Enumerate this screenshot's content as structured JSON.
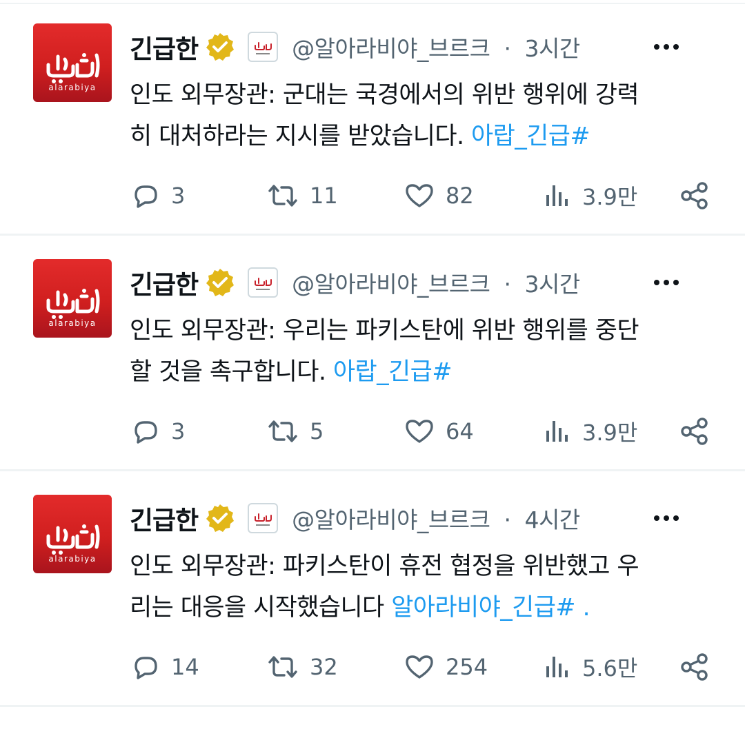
{
  "tweets": [
    {
      "display_name": "긴급한",
      "handle": "@알아라비야_브르크",
      "separator": "·",
      "time": "3시간",
      "text_lines": [
        "인도 외무장관: 군대는 국경에서의 위반 행위에 강력",
        "히 대처하라는 지시를 받았습니다. "
      ],
      "hashtag": "아랍_긴급#",
      "replies": "3",
      "retweets": "11",
      "likes": "82",
      "views": "3.9만"
    },
    {
      "display_name": "긴급한",
      "handle": "@알아라비야_브르크",
      "separator": "·",
      "time": "3시간",
      "text_lines": [
        "인도 외무장관: 우리는 파키스탄에 위반 행위를 중단",
        "할 것을 촉구합니다.   "
      ],
      "hashtag": "아랍_긴급#",
      "replies": "3",
      "retweets": "5",
      "likes": "64",
      "views": "3.9만"
    },
    {
      "display_name": "긴급한",
      "handle": "@알아라비야_브르크",
      "separator": "·",
      "time": "4시간",
      "text_lines": [
        "인도 외무장관: 파키스탄이 휴전 협정을 위반했고 우",
        "리는 대응을 시작했습니다   "
      ],
      "hashtag": "알아라비야_긴급# .",
      "replies": "14",
      "retweets": "32",
      "likes": "254",
      "views": "5.6만"
    }
  ],
  "brand": {
    "avatar_logo_text": "العربية",
    "avatar_subtext": "alarabiya"
  },
  "colors": {
    "hashtag": "#1d9bf0",
    "secondary_text": "#536471",
    "verified_gold": "#e2b719",
    "avatar_red": "#d01f1f"
  },
  "icons": {
    "reply": "speech-bubble-icon",
    "retweet": "retweet-icon",
    "like": "heart-icon",
    "views": "bar-chart-icon",
    "share": "share-icon",
    "more": "more-dots-icon",
    "verified": "gold-verified-badge-icon"
  }
}
